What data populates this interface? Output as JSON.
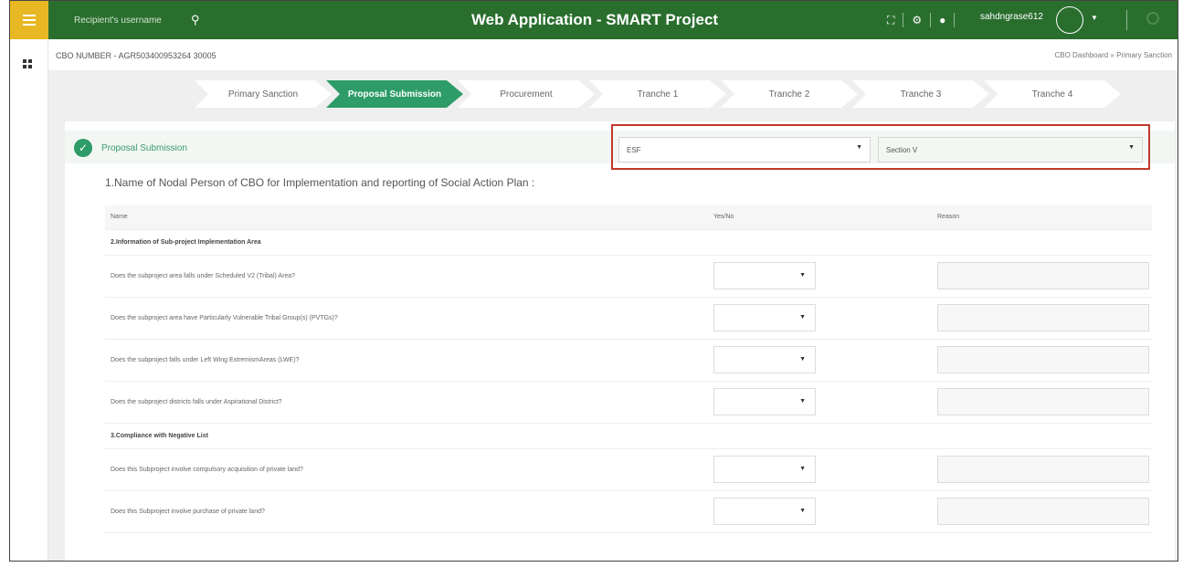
{
  "app": {
    "title": "Web Application - SMART Project",
    "search_placeholder": "Recipient's username",
    "username": "sahdngrase612"
  },
  "breadcrumb": {
    "cbo_number": "CBO NUMBER - AGR503400953264 30005",
    "trail": "CBO Dashboard  »  Primary Sanction"
  },
  "steps": [
    {
      "label": "Primary Sanction",
      "active": false
    },
    {
      "label": "Proposal Submission",
      "active": true
    },
    {
      "label": "Procurement",
      "active": false
    },
    {
      "label": "Tranche 1",
      "active": false
    },
    {
      "label": "Tranche 2",
      "active": false
    },
    {
      "label": "Tranche 3",
      "active": false
    },
    {
      "label": "Tranche 4",
      "active": false
    }
  ],
  "panel": {
    "title": "Proposal Submission",
    "dropdown1_value": "ESF",
    "dropdown2_value": "Section V",
    "question": "1.Name of Nodal Person of CBO for Implementation and reporting of Social Action Plan :"
  },
  "table": {
    "headers": [
      "Name",
      "Yes/No",
      "Reason"
    ],
    "rows": [
      {
        "type": "section",
        "text": "2.Information of Sub-project Implementation Area"
      },
      {
        "type": "question",
        "text": "Does the subproject area falls under Scheduled V2 (Tribal) Area?"
      },
      {
        "type": "question",
        "text": "Does the subproject area have Particularly Vulnerable Tribal Group(s) (PVTGs)?"
      },
      {
        "type": "question",
        "text": "Does the subproject falls under Left Wing ExtremismAreas (LWE)?"
      },
      {
        "type": "question",
        "text": "Does the subproject districts falls under Aspirational District?"
      },
      {
        "type": "section",
        "text": "3.Compliance with Negative List"
      },
      {
        "type": "question",
        "text": "Does this Subproject involve compulsory acquisition of private land?"
      },
      {
        "type": "question",
        "text": "Does this Subproject involve purchase of private land?"
      }
    ]
  },
  "colors": {
    "topbar": "#2a6e2e",
    "hamburger": "#e8b824",
    "accent": "#2e9c68",
    "highlight": "#c0392b"
  }
}
